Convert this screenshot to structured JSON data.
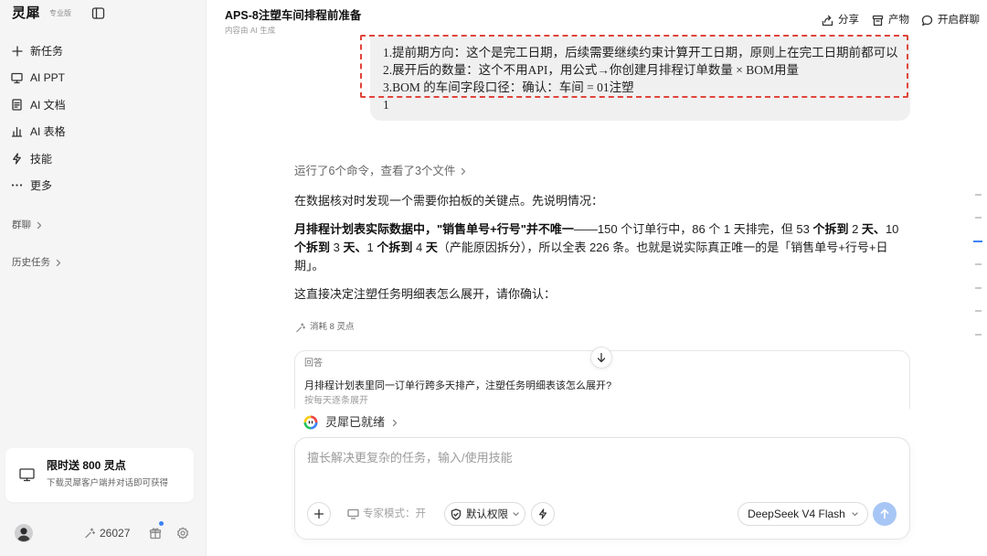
{
  "app": {
    "name": "灵犀",
    "edition": "专业版"
  },
  "sidebar": {
    "menu": [
      {
        "label": "新任务",
        "icon": "plus-icon"
      },
      {
        "label": "AI PPT",
        "icon": "presentation-icon"
      },
      {
        "label": "AI 文档",
        "icon": "document-icon"
      },
      {
        "label": "AI 表格",
        "icon": "bar-chart-icon"
      },
      {
        "label": "技能",
        "icon": "lightning-icon"
      },
      {
        "label": "更多",
        "icon": "more-icon"
      }
    ],
    "groups": [
      {
        "label": "群聊",
        "icon": "chevron-right-icon"
      },
      {
        "label": "历史任务",
        "icon": "chevron-right-icon"
      }
    ],
    "promo": {
      "title": "限时送 800 灵点",
      "subtitle": "下载灵犀客户端并对话即可获得",
      "icon": "monitor-icon"
    },
    "footer": {
      "points": "26027"
    }
  },
  "header": {
    "title": "APS-8注塑车间排程前准备",
    "subtitle": "内容由 AI 生成",
    "actions": [
      {
        "label": "分享",
        "icon": "share-icon"
      },
      {
        "label": "产物",
        "icon": "archive-icon"
      },
      {
        "label": "开启群聊",
        "icon": "chat-icon"
      }
    ]
  },
  "conversation": {
    "user_message": [
      "1.提前期方向：这个是完工日期，后续需要继续约束计算开工日期，原则上在完工日期前都可以",
      "2.展开后的数量：这个不用API，用公式→你创建月排程订单数量 × BOM用量",
      "3.BOM 的车间字段口径：确认：车间 = 01注塑",
      "1"
    ],
    "activity": "运行了6个命令，查看了3个文件",
    "intro": "在数据核对时发现一个需要你拍板的关键点。先说明情况：",
    "detail": [
      "月排程计划表实际数据中，\"销售单号+行号\"并不唯一",
      "——150 个订单行中，86 个 1 天排完，但 53 ",
      "个拆到",
      " 2 ",
      "天、",
      "10 ",
      "个拆到",
      " 3 ",
      "天、",
      "1 ",
      "个拆到",
      " 4 ",
      "天",
      "（产能原因拆分），所以全表 226 条。也就是说实际真正唯一的是「销售单号+行号+日期」。"
    ],
    "ask": "这直接决定注塑任务明细表怎么展开，请你确认：",
    "cost": "消耗 8 灵点",
    "answer_card": {
      "label": "回答",
      "question": "月排程计划表里同一订单行跨多天排产，注塑任务明细表该怎么展开?",
      "option": "按每天逐条展开"
    },
    "status": "灵犀已就绪"
  },
  "composer": {
    "placeholder": "擅长解决更复杂的任务，输入/使用技能",
    "expert_mode": "专家模式：开",
    "permission": "默认权限",
    "model": "DeepSeek V4 Flash"
  },
  "colors": {
    "accent": "#3b82f6",
    "send_button": "#a8c6f5",
    "annotation": "#e0453a",
    "sidebar_background": "#f5f5f6",
    "user_bubble": "#f0f0f1"
  }
}
